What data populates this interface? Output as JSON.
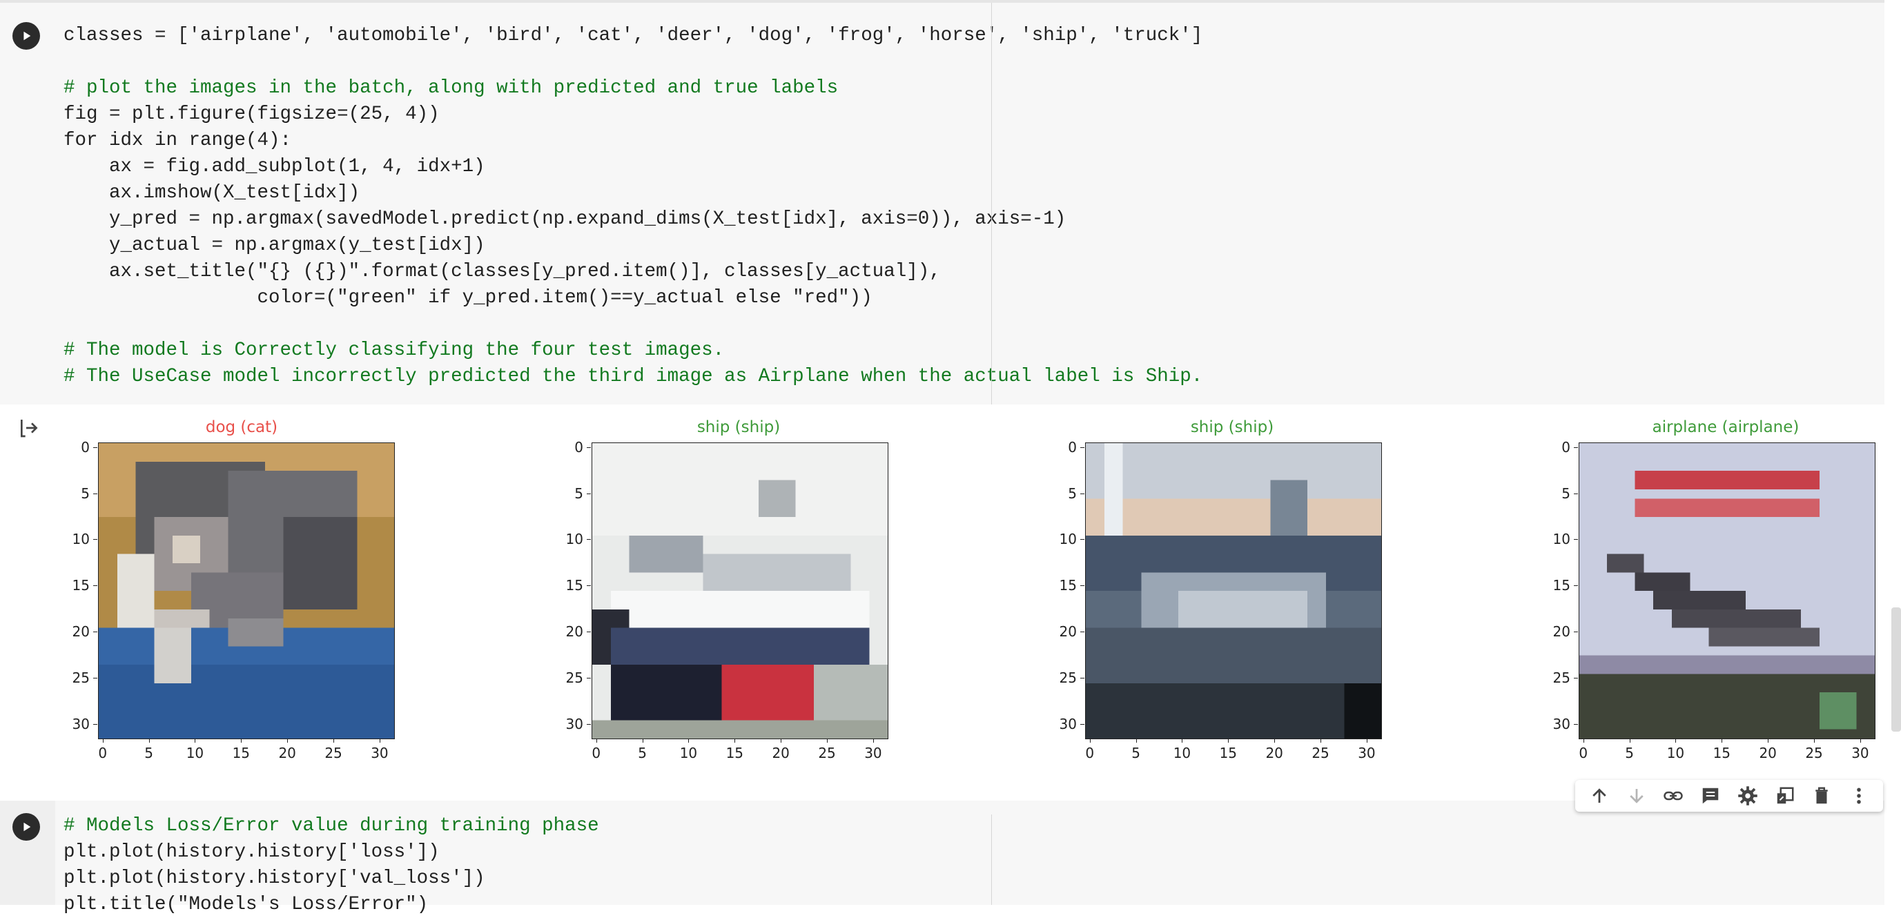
{
  "cell1": {
    "run_button_label": "Run cell",
    "code_lines": [
      "classes = ['airplane', 'automobile', 'bird', 'cat', 'deer', 'dog', 'frog', 'horse', 'ship', 'truck']",
      "",
      "# plot the images in the batch, along with predicted and true labels",
      "fig = plt.figure(figsize=(25, 4))",
      "for idx in range(4):",
      "    ax = fig.add_subplot(1, 4, idx+1)",
      "    ax.imshow(X_test[idx])",
      "    y_pred = np.argmax(savedModel.predict(np.expand_dims(X_test[idx], axis=0)), axis=-1)",
      "    y_actual = np.argmax(y_test[idx])",
      "    ax.set_title(\"{} ({})\".format(classes[y_pred.item()], classes[y_actual]),",
      "                 color=(\"green\" if y_pred.item()==y_actual else \"red\"))",
      "",
      "# The model is Correctly classifying the four test images.",
      "# The UseCase model incorrectly predicted the third image as Airplane when the actual label is Ship."
    ]
  },
  "output": {
    "icon": "output-arrow-icon",
    "plots": [
      {
        "title": "dog (cat)",
        "title_color": "#e8504a"
      },
      {
        "title": "ship (ship)",
        "title_color": "#3f9b3a"
      },
      {
        "title": "ship (ship)",
        "title_color": "#3f9b3a"
      },
      {
        "title": "airplane (airplane)",
        "title_color": "#3f9b3a"
      }
    ],
    "y_ticks": [
      "0",
      "5",
      "10",
      "15",
      "20",
      "25",
      "30"
    ],
    "x_ticks": [
      "0",
      "5",
      "10",
      "15",
      "20",
      "25",
      "30"
    ]
  },
  "cell2": {
    "code_lines": [
      "# Models Loss/Error value during training phase",
      "plt.plot(history.history['loss'])",
      "plt.plot(history.history['val_loss'])",
      "plt.title(\"Models's Loss/Error\")"
    ]
  },
  "toolbar": {
    "items": [
      "move-up-icon",
      "move-down-icon",
      "link-icon",
      "comment-icon",
      "settings-icon",
      "mirror-cell-icon",
      "delete-icon",
      "more-options-icon"
    ]
  }
}
